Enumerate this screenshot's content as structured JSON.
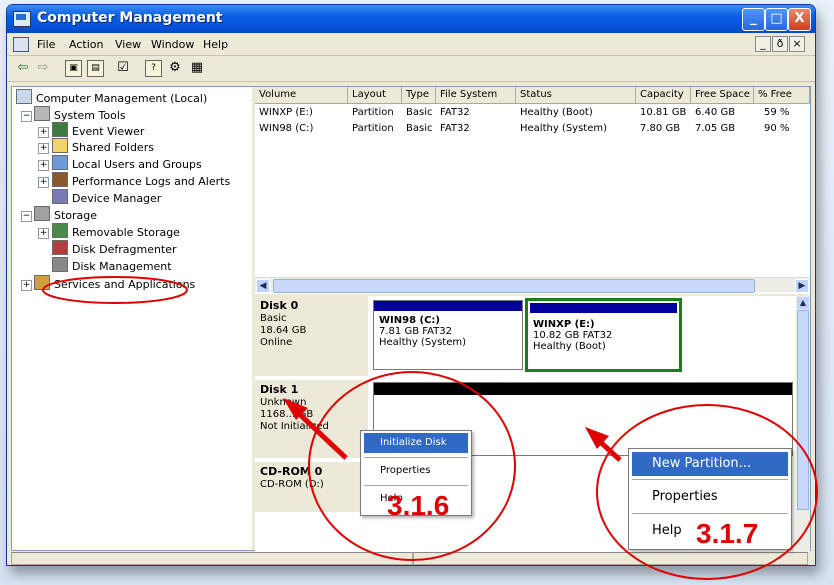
{
  "window": {
    "title": "Computer Management",
    "buttons": {
      "minimize": "_",
      "maximize": "□",
      "close": "X"
    }
  },
  "menubar": {
    "items": [
      "File",
      "Action",
      "View",
      "Window",
      "Help"
    ],
    "mdi_controls": [
      "_",
      "ð",
      "×"
    ]
  },
  "toolbar": {
    "icons": [
      "back-arrow-icon",
      "forward-arrow-icon",
      "up-folder-icon",
      "show-hide-tree-icon",
      "properties-icon",
      "help-icon",
      "settings-icon",
      "disk-icon"
    ]
  },
  "tree": {
    "items": [
      {
        "label": "Computer Management (Local)",
        "expander": ""
      },
      {
        "label": "System Tools",
        "expander": "−"
      },
      {
        "label": "Event Viewer",
        "expander": "+"
      },
      {
        "label": "Shared Folders",
        "expander": "+"
      },
      {
        "label": "Local Users and Groups",
        "expander": "+"
      },
      {
        "label": "Performance Logs and Alerts",
        "expander": "+"
      },
      {
        "label": "Device Manager",
        "expander": ""
      },
      {
        "label": "Storage",
        "expander": "−"
      },
      {
        "label": "Removable Storage",
        "expander": "+"
      },
      {
        "label": "Disk Defragmenter",
        "expander": ""
      },
      {
        "label": "Disk Management",
        "expander": ""
      },
      {
        "label": "Services and Applications",
        "expander": "+"
      }
    ]
  },
  "volume_list": {
    "columns": [
      "Volume",
      "Layout",
      "Type",
      "File System",
      "Status",
      "Capacity",
      "Free Space",
      "% Free"
    ],
    "rows": [
      [
        "WINXP (E:)",
        "Partition",
        "Basic",
        "FAT32",
        "Healthy (Boot)",
        "10.81 GB",
        "6.40 GB",
        "59 %"
      ],
      [
        "WIN98 (C:)",
        "Partition",
        "Basic",
        "FAT32",
        "Healthy (System)",
        "7.80 GB",
        "7.05 GB",
        "90 %"
      ]
    ]
  },
  "disks": {
    "disk0": {
      "name": "Disk 0",
      "type": "Basic",
      "size": "18.64 GB",
      "state": "Online",
      "partitions": [
        {
          "name": "WIN98 (C:)",
          "size": "7.81 GB FAT32",
          "status": "Healthy (System)"
        },
        {
          "name": "WINXP (E:)",
          "size": "10.82 GB FAT32",
          "status": "Healthy (Boot)"
        }
      ]
    },
    "disk1": {
      "name": "Disk 1",
      "type": "Unknown",
      "size": "1168.…GB",
      "state": "Not Initialized"
    },
    "cdrom": {
      "name": "CD-ROM 0",
      "type": "CD-ROM (D:)"
    }
  },
  "context_menu_disk": {
    "items": [
      "Initialize Disk",
      "Properties",
      "Help"
    ]
  },
  "context_menu_unallocated": {
    "items": [
      "New Partition...",
      "Properties",
      "Help"
    ]
  },
  "annotations": {
    "step1": "3.1.6",
    "step2": "3.1.7",
    "color": "#e00000"
  },
  "colors": {
    "titlebar": "#0a5fe3",
    "partition_cap": "#00009e",
    "unallocated_cap": "#000000",
    "selected_partition_border": "#1e7b1e",
    "menu_selection": "#316ac5"
  }
}
